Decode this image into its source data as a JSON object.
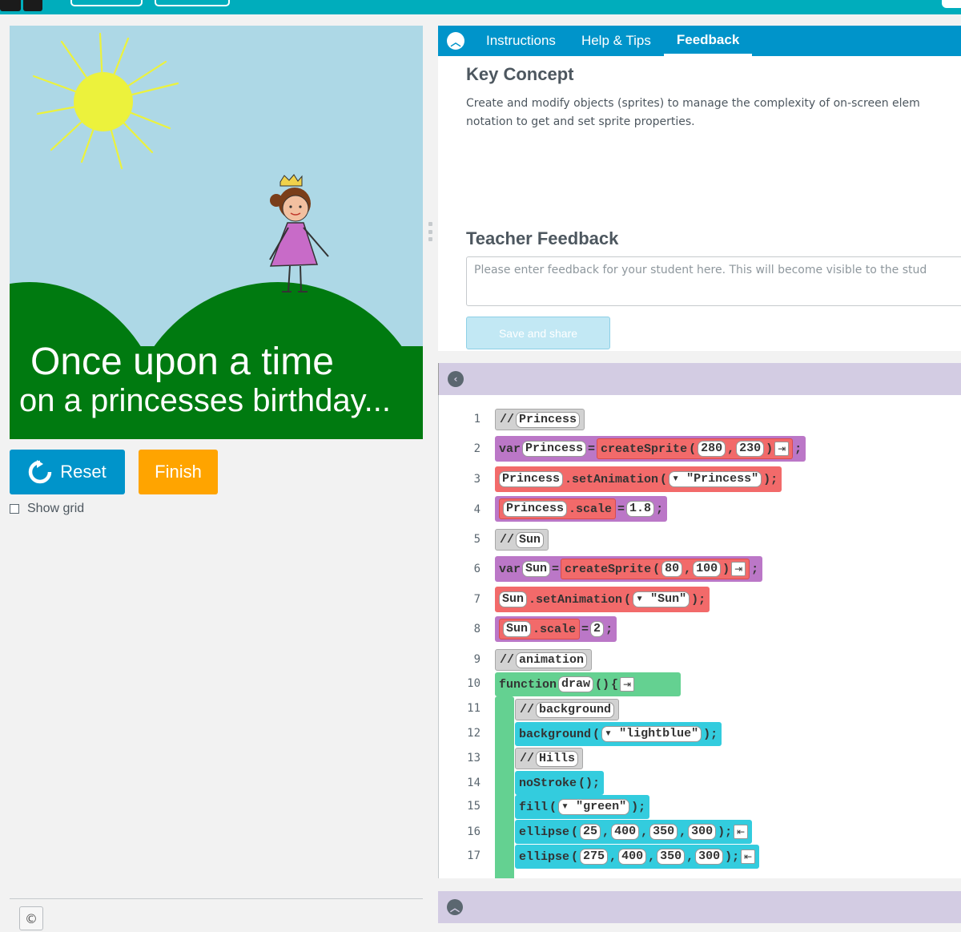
{
  "topbar": {
    "accent": "#00adbc"
  },
  "stage": {
    "line1": "Once upon a time",
    "line2": "on a princesses birthday..."
  },
  "controls": {
    "reset_label": "Reset",
    "finish_label": "Finish",
    "show_grid_label": "Show grid",
    "version_icon": "©"
  },
  "instructions": {
    "tabs": [
      "Instructions",
      "Help & Tips",
      "Feedback"
    ],
    "active_tab": "Feedback",
    "key_concept_title": "Key Concept",
    "key_concept_line1": "Create and modify objects (sprites) to manage the complexity of on-screen elem",
    "key_concept_line2": "notation to get and set sprite properties.",
    "teacher_feedback_title": "Teacher Feedback",
    "feedback_placeholder": "Please enter feedback for your student here. This will become visible to the stud",
    "save_label": "Save and share"
  },
  "code": {
    "lines": [
      "1",
      "2",
      "3",
      "4",
      "5",
      "6",
      "7",
      "8",
      "9",
      "10",
      "11",
      "12",
      "13",
      "14",
      "15",
      "16",
      "17"
    ],
    "l1_comment": "Princess",
    "l2_var": "var",
    "l2_name": "Princess",
    "l2_eq": "=",
    "l2_fn": "createSprite",
    "l2_a": "280",
    "l2_b": "230",
    "l3_obj": "Princess",
    "l3_method": ".setAnimation",
    "l3_arg": "\"Princess\"",
    "l4_obj": "Princess",
    "l4_prop": ".scale",
    "l4_eq": "=",
    "l4_val": "1.8",
    "l5_comment": "Sun",
    "l6_var": "var",
    "l6_name": "Sun",
    "l6_eq": "=",
    "l6_fn": "createSprite",
    "l6_a": "80",
    "l6_b": "100",
    "l7_obj": "Sun",
    "l7_method": ".setAnimation",
    "l7_arg": "\"Sun\"",
    "l8_obj": "Sun",
    "l8_prop": ".scale",
    "l8_eq": "=",
    "l8_val": "2",
    "l9_comment": "animation",
    "l10_kw": "function",
    "l10_name": "draw",
    "l10_parens": "()",
    "l10_brace": "{",
    "l11_comment": "background",
    "l12_fn": "background",
    "l12_arg": "\"lightblue\"",
    "l13_comment": "Hills",
    "l14_fn": "noStroke",
    "l14_rest": "();",
    "l15_fn": "fill",
    "l15_arg": "\"green\"",
    "l16_fn": "ellipse",
    "l16_args": [
      "25",
      "400",
      "350",
      "300"
    ],
    "l17_fn": "ellipse",
    "l17_args": [
      "275",
      "400",
      "350",
      "300"
    ]
  }
}
